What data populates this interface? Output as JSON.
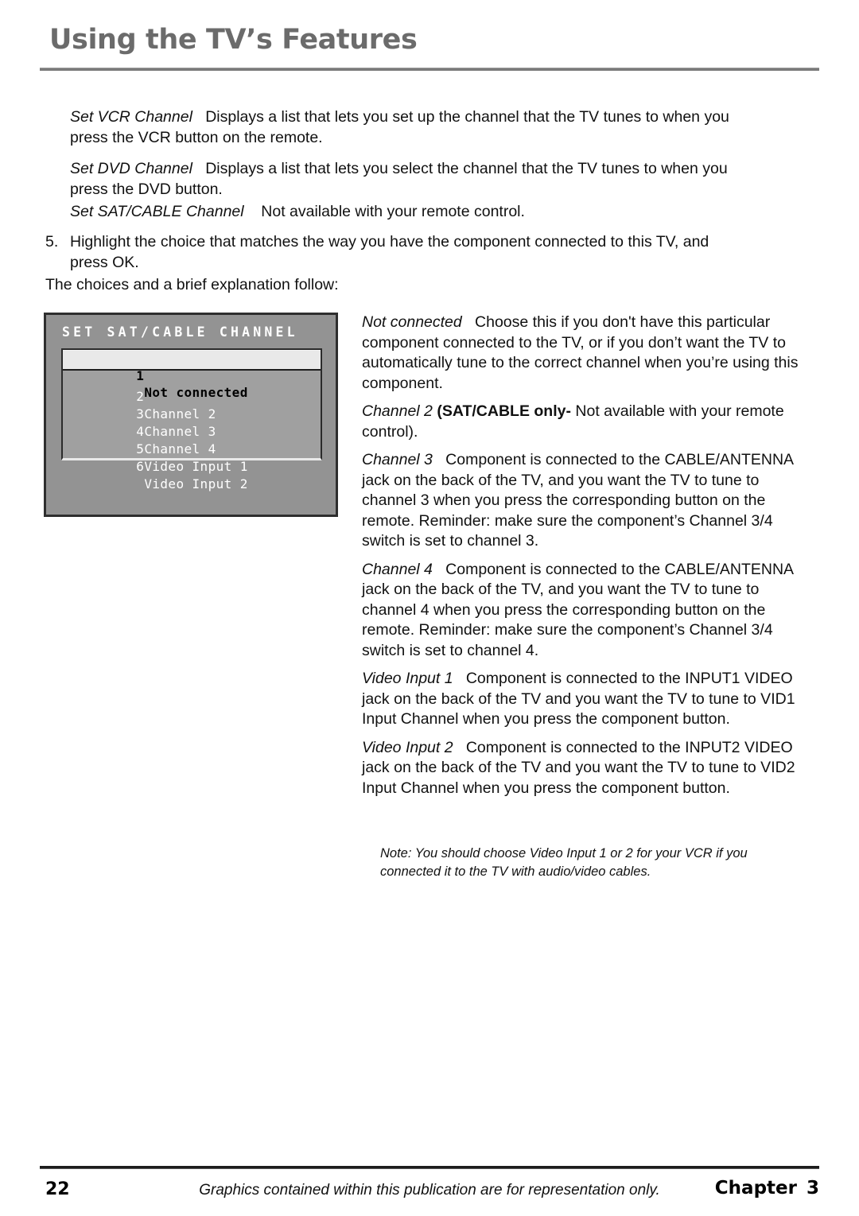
{
  "header": {
    "title": "Using the TV’s Features"
  },
  "content": {
    "para_vcr": {
      "term": "Set VCR Channel",
      "text": "Displays a list that lets you set up the channel that the TV tunes to when you press the VCR button on the remote."
    },
    "para_dvd": {
      "term": "Set DVD Channel",
      "text": "Displays a list that lets you select the channel that the TV tunes to when you press the DVD button."
    },
    "para_sat": {
      "term": "Set SAT/CABLE Channel",
      "text": "Not available with your remote control."
    },
    "step5": {
      "number": "5.",
      "text": "Highlight the choice that matches the way you have the component connected to this TV, and press OK."
    },
    "choices_intro": "The choices and a brief explanation follow:"
  },
  "tv_screen": {
    "title": "SET SAT/CABLE CHANNEL",
    "items": [
      {
        "index": "1",
        "label": "Not connected",
        "selected": true
      },
      {
        "index": "2",
        "label": "Channel 2",
        "selected": false
      },
      {
        "index": "3",
        "label": "Channel 3",
        "selected": false
      },
      {
        "index": "4",
        "label": "Channel 4",
        "selected": false
      },
      {
        "index": "5",
        "label": "Video Input 1",
        "selected": false
      },
      {
        "index": "6",
        "label": "Video Input 2",
        "selected": false
      }
    ],
    "colors": {
      "panel_background": "#939393",
      "list_background": "#a0a0a0",
      "selected_background": "#e9e9e9",
      "border": "#2e2e2e",
      "text": "#ffffff",
      "selected_text": "#000000"
    }
  },
  "descriptions": {
    "not_connected": {
      "term": "Not connected",
      "text": "Choose this if you don't have this particular component connected to the TV, or if you don’t want the TV to automatically tune to the correct channel when you’re using this component."
    },
    "channel_2": {
      "term": "Channel 2",
      "bold": "(SAT/CABLE only-",
      "text": "Not available with your remote control)."
    },
    "channel_3": {
      "term": "Channel 3",
      "text": "Component is connected to the CABLE/ANTENNA jack on the back of the TV, and you want the TV to tune to channel 3 when you press the corresponding button on the remote. Reminder: make sure the component’s Channel 3/4 switch is set to channel 3."
    },
    "channel_4": {
      "term": "Channel 4",
      "text": "Component is connected to the CABLE/ANTENNA jack on the back of the TV, and you want the TV to tune to channel 4 when you press the corresponding button on the remote. Reminder: make sure the component’s Channel 3/4 switch is set to channel 4."
    },
    "video_input_1": {
      "term": "Video Input 1",
      "text": "Component is connected to the INPUT1 VIDEO jack on the back of the TV and you want the TV to tune to VID1 Input Channel when you press the component button."
    },
    "video_input_2": {
      "term": "Video Input 2",
      "text": "Component is connected to the INPUT2 VIDEO jack on the back of the TV and you want the TV to tune to VID2 Input Channel when you press the component button."
    },
    "note": "Note: You should choose Video Input 1 or 2  for your VCR if you connected it to the TV with audio/video cables."
  },
  "footer": {
    "page_number": "22",
    "center_text": "Graphics contained within this publication are for representation only.",
    "chapter_label": "Chapter",
    "chapter_number": "3"
  }
}
